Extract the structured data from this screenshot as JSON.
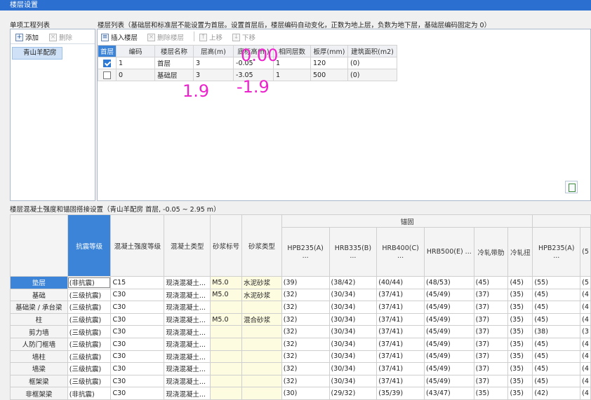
{
  "window": {
    "title": "楼层设置"
  },
  "left": {
    "title": "单项工程列表",
    "add": "添加",
    "delete": "删除",
    "projects": [
      "青山羊配房"
    ]
  },
  "floors": {
    "title": "楼层列表（基础层和标准层不能设置为首层。设置首层后，楼层编码自动变化，正数为地上层，负数为地下层，基础层编码固定为 0）",
    "toolbar": {
      "insert": "插入楼层",
      "remove": "删除楼层",
      "up": "上移",
      "down": "下移"
    },
    "headers": [
      "首层",
      "编码",
      "楼层名称",
      "层高(m)",
      "底标高(m)",
      "相同层数",
      "板厚(mm)",
      "建筑面积(m2)"
    ],
    "rows": [
      {
        "checked": true,
        "code": "1",
        "name": "首层",
        "height": "3",
        "bottom": "-0.05",
        "same": "1",
        "slab": "120",
        "area": "(0)"
      },
      {
        "checked": false,
        "code": "0",
        "name": "基础层",
        "height": "3",
        "bottom": "-3.05",
        "same": "1",
        "slab": "500",
        "area": "(0)"
      }
    ],
    "annotations": {
      "a1": "0.00",
      "a2": "1.9",
      "a3": "-1.9"
    }
  },
  "concrete": {
    "title": "楼层混凝土强度和锚固搭接设置（青山羊配房 首层, -0.05 ~ 2.95 m）",
    "group": "锚固",
    "headers": [
      "抗震等级",
      "混凝土强度等级",
      "混凝土类型",
      "砂浆标号",
      "砂浆类型",
      "HPB235(A) ...",
      "HRB335(B) ...",
      "HRB400(C) ...",
      "HRB500(E) ...",
      "冷轧带肋",
      "冷轧扭",
      "HPB235(A) ...",
      "(5"
    ],
    "rows": [
      [
        "垫层",
        "(非抗震)",
        "C15",
        "现浇混凝土...",
        "M5.0",
        "水泥砂浆",
        "(39)",
        "(38/42)",
        "(40/44)",
        "(48/53)",
        "(45)",
        "(45)",
        "(55)",
        "(5"
      ],
      [
        "基础",
        "(三级抗震)",
        "C30",
        "现浇混凝土...",
        "M5.0",
        "水泥砂浆",
        "(32)",
        "(30/34)",
        "(37/41)",
        "(45/49)",
        "(37)",
        "(35)",
        "(45)",
        "(4"
      ],
      [
        "基础梁 / 承台梁",
        "(三级抗震)",
        "C30",
        "现浇混凝土...",
        "",
        "",
        "(32)",
        "(30/34)",
        "(37/41)",
        "(45/49)",
        "(37)",
        "(35)",
        "(45)",
        "(4"
      ],
      [
        "柱",
        "(三级抗震)",
        "C30",
        "现浇混凝土...",
        "M5.0",
        "混合砂浆",
        "(32)",
        "(30/34)",
        "(37/41)",
        "(45/49)",
        "(37)",
        "(35)",
        "(45)",
        "(4"
      ],
      [
        "剪力墙",
        "(三级抗震)",
        "C30",
        "现浇混凝土...",
        "",
        "",
        "(32)",
        "(30/34)",
        "(37/41)",
        "(45/49)",
        "(37)",
        "(35)",
        "(38)",
        "(3"
      ],
      [
        "人防门框墙",
        "(三级抗震)",
        "C30",
        "现浇混凝土...",
        "",
        "",
        "(32)",
        "(30/34)",
        "(37/41)",
        "(45/49)",
        "(37)",
        "(35)",
        "(45)",
        "(4"
      ],
      [
        "墙柱",
        "(三级抗震)",
        "C30",
        "现浇混凝土...",
        "",
        "",
        "(32)",
        "(30/34)",
        "(37/41)",
        "(45/49)",
        "(37)",
        "(35)",
        "(45)",
        "(4"
      ],
      [
        "墙梁",
        "(三级抗震)",
        "C30",
        "现浇混凝土...",
        "",
        "",
        "(32)",
        "(30/34)",
        "(37/41)",
        "(45/49)",
        "(37)",
        "(35)",
        "(45)",
        "(4"
      ],
      [
        "框架梁",
        "(三级抗震)",
        "C30",
        "现浇混凝土...",
        "",
        "",
        "(32)",
        "(30/34)",
        "(37/41)",
        "(45/49)",
        "(37)",
        "(35)",
        "(45)",
        "(4"
      ],
      [
        "非框架梁",
        "(非抗震)",
        "C30",
        "现浇混凝土...",
        "",
        "",
        "(30)",
        "(29/32)",
        "(35/39)",
        "(43/47)",
        "(35)",
        "(35)",
        "(42)",
        "(4"
      ]
    ]
  },
  "colors": {
    "accent": "#3b84d8",
    "annotation": "#ee22cc",
    "mortar_cell": "#fdfbe0"
  }
}
